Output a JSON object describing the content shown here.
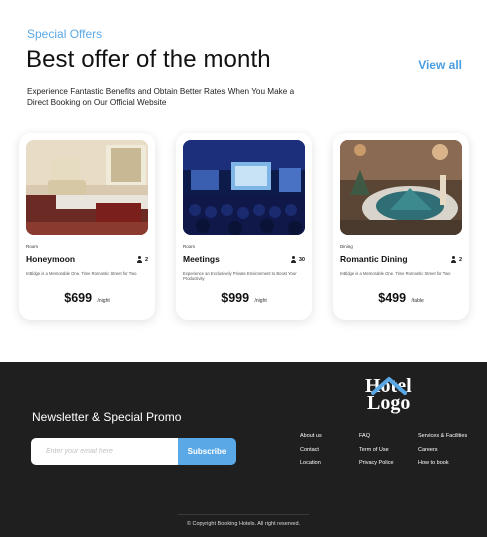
{
  "offers": {
    "eyebrow": "Special Offers",
    "headline": "Best offer of the month",
    "view_all": "View all",
    "subtext": "Experience Fantastic Benefits and Obtain Better Rates When You Make a Direct Booking on Our Official Website"
  },
  "cards": [
    {
      "category": "Room",
      "title": "Honeymoon",
      "guests": "2",
      "description": "InBldge is a Memorable One. Time Romantic Street for Two",
      "price": "$699",
      "per": "/night"
    },
    {
      "category": "Room",
      "title": "Meetings",
      "guests": "30",
      "description": "Experience an Exclusively Private Environment to Boost Your Productivity",
      "price": "$999",
      "per": "/night"
    },
    {
      "category": "Dining",
      "title": "Romantic Dining",
      "guests": "2",
      "description": "InBldge is a Memorable One. Time Romantic Street for Two",
      "price": "$499",
      "per": "/table"
    }
  ],
  "footer": {
    "newsletter_title": "Newsletter & Special Promo",
    "email_placeholder": "Enter your email here",
    "subscribe_label": "Subscribe",
    "logo_line1": "Hotel",
    "logo_line2": "Logo",
    "links_col1": [
      "About us",
      "Contact",
      "Location"
    ],
    "links_col2": [
      "FAQ",
      "Term of Use",
      "Privacy Police"
    ],
    "links_col3": [
      "Services & Facilities",
      "Careers",
      "How to book"
    ],
    "copyright": "© Copyright Booking Hotels. All right reserved."
  },
  "colors": {
    "accent": "#5aa9e6",
    "footer_bg": "#1f1f1f"
  }
}
